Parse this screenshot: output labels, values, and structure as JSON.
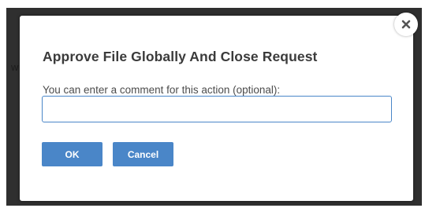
{
  "background": {
    "partial_text": "w"
  },
  "dialog": {
    "title": "Approve File Globally And Close Request",
    "comment_label": "You can enter a comment for this action (optional):",
    "comment_value": "",
    "ok_label": "OK",
    "cancel_label": "Cancel",
    "close_icon": "close-icon"
  },
  "colors": {
    "primary": "#4a86c8",
    "title_text": "#3b3b3b",
    "backdrop": "#2f2f2f"
  }
}
